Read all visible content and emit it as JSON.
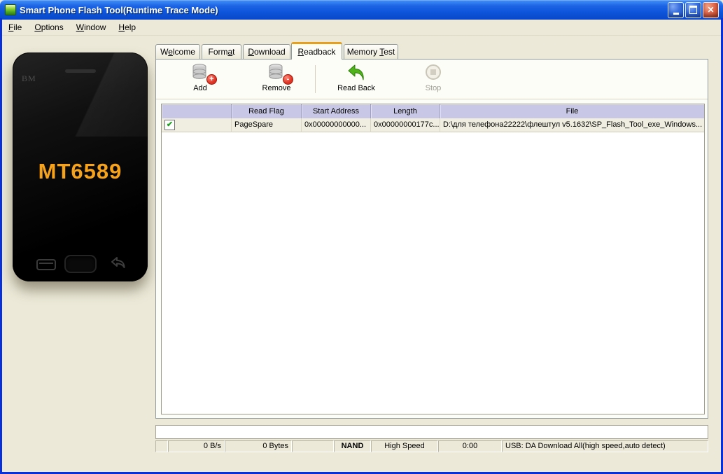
{
  "window": {
    "title": "Smart Phone Flash Tool(Runtime Trace Mode)"
  },
  "menu": {
    "items": [
      {
        "pre": "",
        "mn": "F",
        "post": "ile"
      },
      {
        "pre": "",
        "mn": "O",
        "post": "ptions"
      },
      {
        "pre": "",
        "mn": "W",
        "post": "indow"
      },
      {
        "pre": "",
        "mn": "H",
        "post": "elp"
      }
    ]
  },
  "phone": {
    "brand": "BM",
    "chip": "MT6589"
  },
  "tabs": [
    {
      "pre": "W",
      "mn": "e",
      "post": "lcome"
    },
    {
      "pre": "Form",
      "mn": "a",
      "post": "t"
    },
    {
      "pre": "",
      "mn": "D",
      "post": "ownload"
    },
    {
      "pre": "",
      "mn": "R",
      "post": "eadback"
    },
    {
      "pre": "Memory ",
      "mn": "T",
      "post": "est"
    }
  ],
  "toolbar": {
    "add_label": "Add",
    "remove_label": "Remove",
    "readback_label": "Read Back",
    "stop_label": "Stop",
    "add_badge": "+",
    "remove_badge": "-"
  },
  "table": {
    "headers": {
      "checkbox": "",
      "read_flag": "Read Flag",
      "start_address": "Start Address",
      "length": "Length",
      "file": "File"
    },
    "rows": [
      {
        "checked": true,
        "check_glyph": "✔",
        "read_flag": "PageSpare",
        "start_address": "0x00000000000...",
        "length": "0x00000000177c...",
        "file": "D:\\для телефона22222\\флештул v5.1632\\SP_Flash_Tool_exe_Windows..."
      }
    ]
  },
  "status_bar": {
    "speed": "0 B/s",
    "size": "0 Bytes",
    "flash_type": "NAND",
    "usb_speed": "High Speed",
    "elapsed": "0:00",
    "connection": "USB: DA Download All(high speed,auto detect)"
  },
  "colors": {
    "window-border": "#0831d9",
    "chrome-bg": "#ece9d8",
    "tab-active-accent": "#e8a01a",
    "grid-header": "#c8c8e6",
    "grid-row": "#f0eee0",
    "chip-orange": "#f7a21b",
    "readback-green": "#3fa313",
    "badge-red": "#dd3324",
    "check-green": "#1ca11c"
  }
}
